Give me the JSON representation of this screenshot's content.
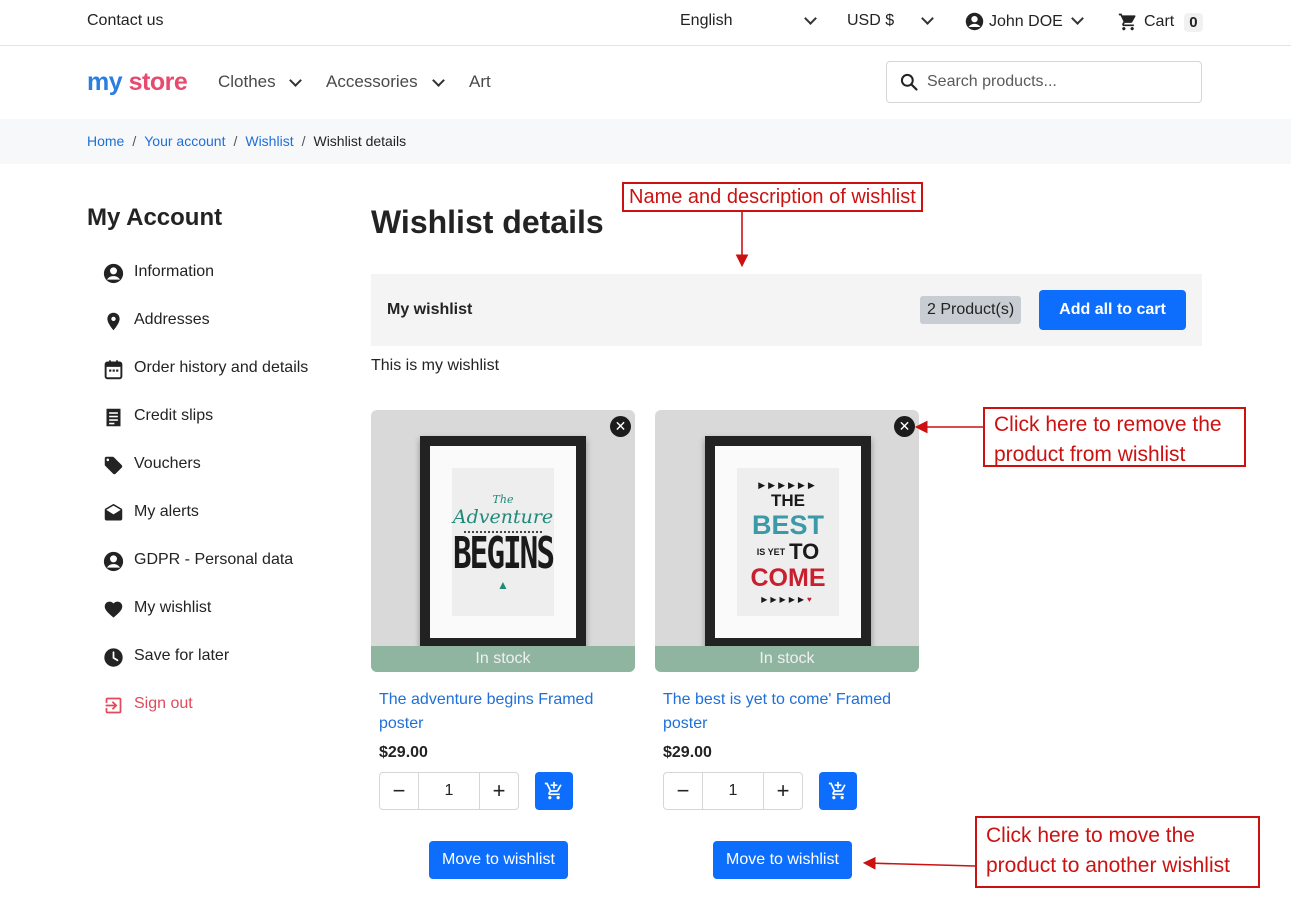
{
  "topbar": {
    "contact": "Contact us",
    "language": "English",
    "currency": "USD $",
    "user": "John DOE",
    "cart_label": "Cart",
    "cart_count": "0"
  },
  "header": {
    "logo_my": "my",
    "logo_store": "store",
    "nav": [
      "Clothes",
      "Accessories",
      "Art"
    ],
    "search_placeholder": "Search products..."
  },
  "breadcrumb": [
    "Home",
    "Your account",
    "Wishlist",
    "Wishlist details"
  ],
  "sidebar": {
    "title": "My Account",
    "items": [
      {
        "label": "Information",
        "icon": "account-circle-icon"
      },
      {
        "label": "Addresses",
        "icon": "location-pin-icon"
      },
      {
        "label": "Order history and details",
        "icon": "calendar-icon"
      },
      {
        "label": "Credit slips",
        "icon": "receipt-icon"
      },
      {
        "label": "Vouchers",
        "icon": "tag-icon"
      },
      {
        "label": "My alerts",
        "icon": "envelope-open-icon"
      },
      {
        "label": "GDPR - Personal data",
        "icon": "account-circle-icon"
      },
      {
        "label": "My wishlist",
        "icon": "heart-icon"
      },
      {
        "label": "Save for later",
        "icon": "clock-icon"
      },
      {
        "label": "Sign out",
        "icon": "logout-icon"
      }
    ]
  },
  "main": {
    "title": "Wishlist details",
    "wishlist_name": "My wishlist",
    "product_count": "2 Product(s)",
    "add_all_label": "Add all to cart",
    "description": "This is my wishlist"
  },
  "products": [
    {
      "name": "The adventure begins Framed poster",
      "price": "$29.00",
      "qty": "1",
      "stock": "In stock",
      "move_label": "Move to wishlist",
      "art": {
        "l1": "The",
        "l2": "Adventure",
        "l3": "BEGINS"
      }
    },
    {
      "name": "The best is yet to come' Framed poster",
      "price": "$29.00",
      "qty": "1",
      "stock": "In stock",
      "move_label": "Move to wishlist",
      "art": {
        "l1": "THE",
        "l2": "BEST",
        "l3": "IS YET",
        "l4": "TO",
        "l5": "COME"
      }
    }
  ],
  "annotations": {
    "name_desc": "Name and description of wishlist",
    "remove": "Click  here to remove the product from wishlist",
    "move": "Click  here to move the product to another wishlist"
  },
  "colors": {
    "primary": "#0d6efd",
    "link": "#1e6fd9",
    "annotation": "#cc1111",
    "stock_bg": "#8fb5a0",
    "signout": "#e04a5a"
  }
}
